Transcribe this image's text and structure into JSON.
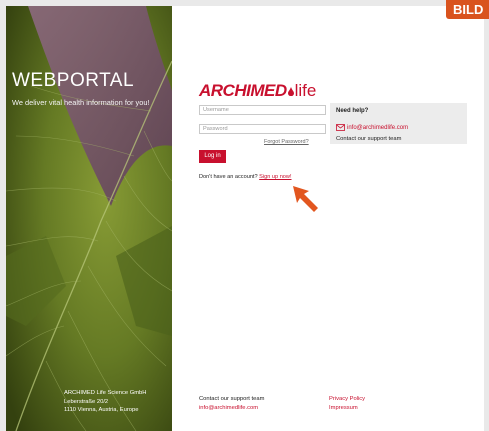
{
  "hero": {
    "title": "WEBPORTAL",
    "tagline": "We deliver vital health information for you!",
    "address": [
      "ARCHIMED Life Science GmbH",
      "Leberstraße 20/2",
      "1110 Vienna, Austria, Europe"
    ]
  },
  "badge": "BILD",
  "logo": {
    "main": "ARCHIMED",
    "suffix": "life"
  },
  "login": {
    "username_placeholder": "Username",
    "password_placeholder": "Password",
    "forgot": "Forgot Password?",
    "button": "Log in",
    "signup_prompt": "Don't have an account?",
    "signup_link": "Sign up now!"
  },
  "help": {
    "title": "Need help?",
    "email": "info@archimedlife.com",
    "contact": "Contact our support team"
  },
  "footer": {
    "left_title": "Contact our support team",
    "left_email": "info@archimedlife.com",
    "privacy": "Privacy Policy",
    "impressum": "Impressum"
  },
  "colors": {
    "brand_red": "#c8102e",
    "badge_orange": "#d9531e",
    "panel_gray": "#ececec"
  },
  "icons": {
    "help_mail": "mail-icon",
    "pointer": "arrow-icon",
    "logo_mark": "drop-icon"
  }
}
